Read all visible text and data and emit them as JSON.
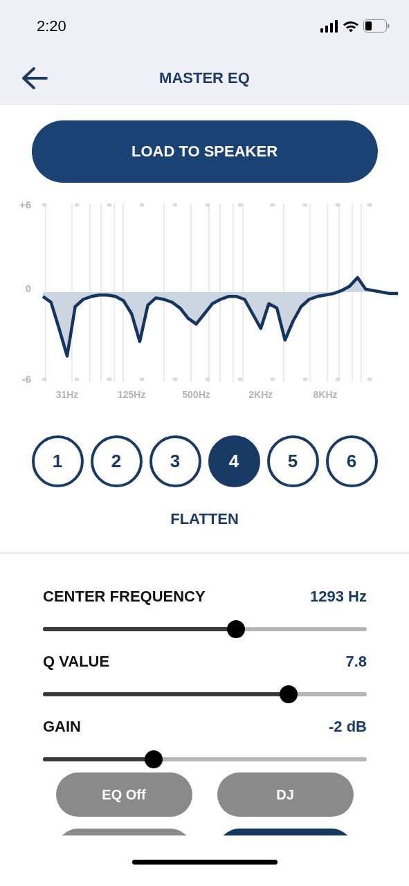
{
  "status_bar": {
    "time": "2:20"
  },
  "header": {
    "title": "MASTER EQ"
  },
  "load_button": {
    "label": "LOAD TO SPEAKER"
  },
  "chart": {
    "chart_data": {
      "type": "area",
      "ylim": [
        -6,
        6
      ],
      "grid": true,
      "categories": [
        null,
        null,
        null,
        "31Hz",
        null,
        null,
        null,
        null,
        null,
        null,
        null,
        "125Hz",
        null,
        null,
        null,
        null,
        null,
        null,
        null,
        "500Hz",
        null,
        null,
        null,
        null,
        null,
        null,
        null,
        "2KHz",
        null,
        null,
        null,
        null,
        null,
        null,
        null,
        "8KHz",
        null,
        null,
        null,
        null,
        null,
        null,
        null,
        null,
        null
      ],
      "yticks": [
        {
          "value": 6,
          "label": "+6"
        },
        {
          "value": 0,
          "label": "0"
        },
        {
          "value": -6,
          "label": "-6"
        }
      ],
      "series": [
        {
          "color": "#14355f",
          "values": [
            -0.3,
            -0.7,
            -2.5,
            -4.4,
            -1.0,
            -0.5,
            -0.3,
            -0.2,
            -0.2,
            -0.3,
            -0.6,
            -1.5,
            -3.4,
            -0.9,
            -0.4,
            -0.5,
            -0.7,
            -1.1,
            -1.8,
            -2.2,
            -1.5,
            -0.8,
            -0.5,
            -0.3,
            -0.3,
            -0.5,
            -1.5,
            -2.5,
            -0.8,
            -1.1,
            -3.3,
            -2.0,
            -1.0,
            -0.5,
            -0.3,
            -0.2,
            -0.1,
            0.1,
            0.4,
            1.0,
            0.2,
            0.1,
            0.0,
            -0.1,
            -0.1
          ]
        }
      ]
    }
  },
  "bands": [
    {
      "label": "1",
      "selected": false
    },
    {
      "label": "2",
      "selected": false
    },
    {
      "label": "3",
      "selected": false
    },
    {
      "label": "4",
      "selected": true
    },
    {
      "label": "5",
      "selected": false
    },
    {
      "label": "6",
      "selected": false
    }
  ],
  "band_type": "FLATTEN",
  "parameters": [
    {
      "label": "CENTER FREQUENCY",
      "value": "1293 Hz",
      "level": 0.596
    },
    {
      "label": "Q VALUE",
      "value": "7.8",
      "level": 0.758
    },
    {
      "label": "GAIN",
      "value": "-2 dB",
      "level": 0.342
    }
  ],
  "presets": [
    {
      "label": "EQ Off",
      "selected": false
    },
    {
      "label": "DJ",
      "selected": false
    },
    {
      "selected": false
    },
    {
      "selected": true
    }
  ]
}
